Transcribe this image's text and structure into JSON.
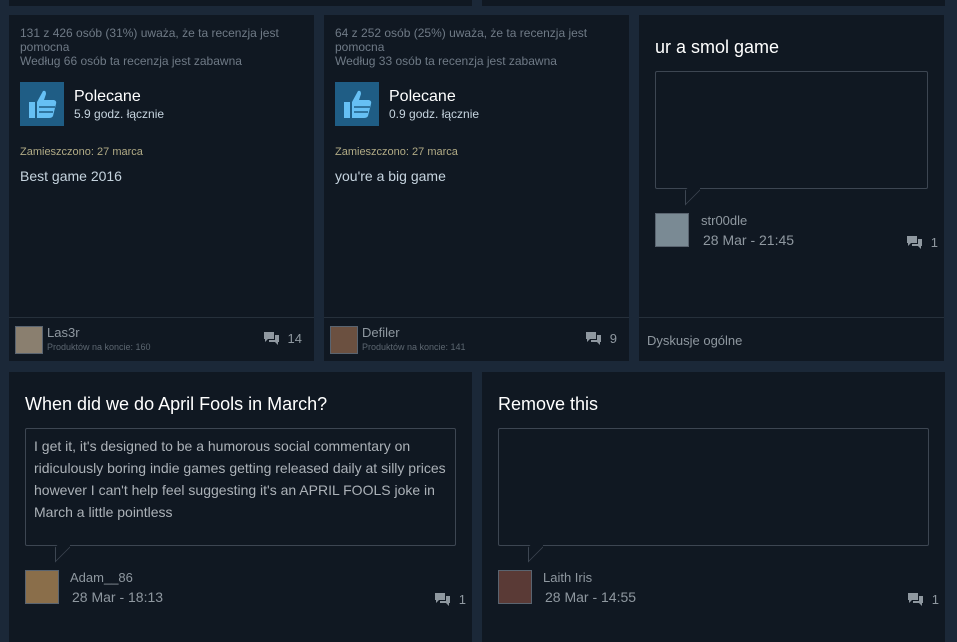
{
  "reviews": [
    {
      "helpful": "131 z 426 osób (31%) uważa, że ta recenzja jest pomocna",
      "funny": "Według 66 osób ta recenzja jest zabawna",
      "verdict": "Polecane",
      "hours": "5.9 godz. łącznie",
      "posted": "Zamieszczono: 27 marca",
      "text": "Best game 2016",
      "author": "Las3r",
      "author_products": "Produktów na koncie: 160",
      "comments": "14"
    },
    {
      "helpful": "64 z 252 osób (25%) uważa, że ta recenzja jest pomocna",
      "funny": "Według 33 osób ta recenzja jest zabawna",
      "verdict": "Polecane",
      "hours": "0.9 godz. łącznie",
      "posted": "Zamieszczono: 27 marca",
      "text": "you're a big game",
      "author": "Defiler",
      "author_products": "Produktów na koncie: 141",
      "comments": "9"
    }
  ],
  "discussions": [
    {
      "title": "ur a smol game",
      "body": "",
      "author": "str00dle",
      "time": "28 Mar - 21:45",
      "comments": "1",
      "forum": "Dyskusje ogólne"
    },
    {
      "title": "When did we do April Fools in March?",
      "body": "I get it, it's designed to be a humorous social commentary on ridiculously boring indie games getting released daily at silly prices however I can't help feel suggesting it's an APRIL FOOLS joke in March a little pointless",
      "author": "Adam__86",
      "time": "28 Mar - 18:13",
      "comments": "1"
    },
    {
      "title": "Remove this",
      "body": "",
      "author": "Laith Iris",
      "time": "28 Mar - 14:55",
      "comments": "1"
    }
  ],
  "icons": {
    "thumb": "thumbs-up-icon",
    "comment": "comment-bubble-icon"
  },
  "colors": {
    "background": "#1b2838",
    "card": "#101822",
    "thumb_bg": "#1f5d85",
    "thumb_icon": "#66c0f4"
  }
}
